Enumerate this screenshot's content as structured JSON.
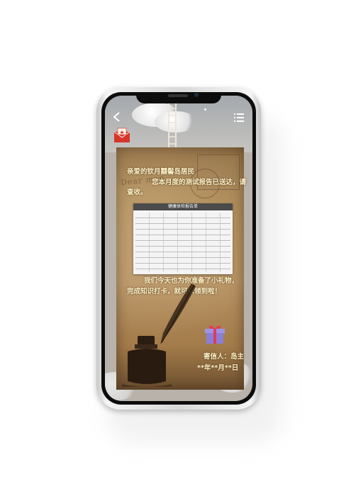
{
  "nav": {
    "back_icon": "chevron-left-icon",
    "menu_icon": "list-icon",
    "mail_icon": "envelope-icon"
  },
  "letter": {
    "watermark": "Dear man",
    "greeting": "亲爱的钦月囍髻岛居民",
    "body_line1": "您本月度的测试报告已送达，请",
    "body_line2": "查收。",
    "report_title": "健康体检报告单",
    "gift_line1": "我们今天也为你准备了小礼物，",
    "gift_line2": "完成知识打卡，就可以领到啦！",
    "sender": "寄信人：岛主",
    "date": "**年**月**日"
  },
  "colors": {
    "letter_text": "#fff3c9",
    "paper": "#b79263"
  }
}
